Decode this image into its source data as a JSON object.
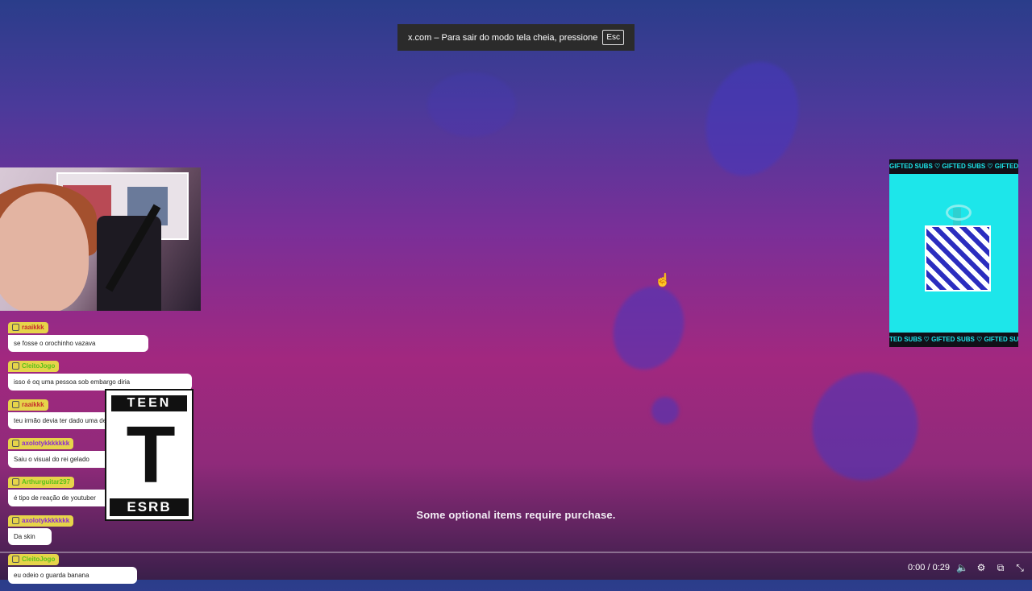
{
  "fullscreen_toast": {
    "text": "x.com – Para sair do modo tela cheia, pressione",
    "key": "Esc"
  },
  "chat": [
    {
      "user": "raaikkk",
      "message": "se fosse o orochinho vazava"
    },
    {
      "user": "CleitoJogo",
      "message": "isso é oq uma pessoa sob embargo diria"
    },
    {
      "user": "raaikkk",
      "message": "teu irmão devia ter dado uma de irmão de patriota"
    },
    {
      "user": "axolotykkkkkkk",
      "message": "Saiu o visual do rei gelado"
    },
    {
      "user": "Arthurguitar297",
      "message": "é tipo de reação de youtuber"
    },
    {
      "user": "axolotykkkkkkk",
      "message": "Da skin"
    },
    {
      "user": "CleitoJogo",
      "message": "eu odeio o guarda banana"
    }
  ],
  "esrb": {
    "top": "TEEN",
    "letter": "T",
    "bottom": "ESRB"
  },
  "gift_banner": {
    "text": "GIFTED SUBS ♡ GIFTED SUBS ♡ GIFTED SUBS",
    "bottom_text": "TED SUBS ♡ GIFTED SUBS ♡ GIFTED SUBS ♡"
  },
  "disclaimer": "Some optional items require purchase.",
  "player": {
    "time": "0:00 / 0:29",
    "icons": [
      "volume-icon",
      "settings-icon",
      "popout-icon",
      "exit-fullscreen-icon"
    ],
    "progress": 0.0
  }
}
